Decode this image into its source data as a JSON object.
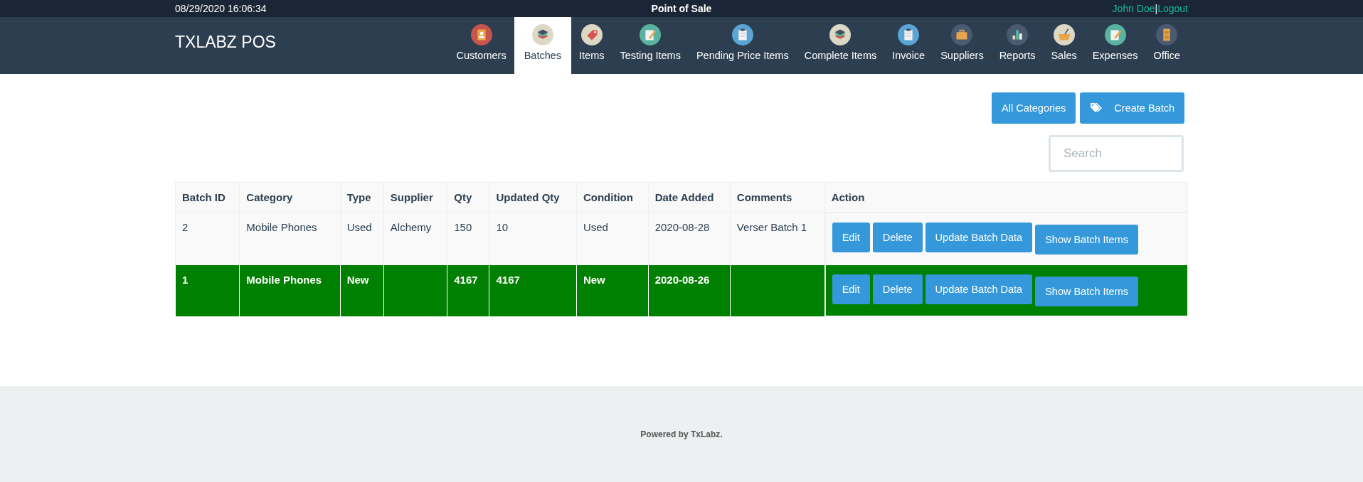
{
  "top_bar": {
    "datetime": "08/29/2020 16:06:34",
    "title": "Point of Sale",
    "user": "John Doe",
    "separator": "|",
    "logout": "Logout"
  },
  "brand": "TXLABZ POS",
  "nav": [
    {
      "label": "Customers",
      "selected": false
    },
    {
      "label": "Batches",
      "selected": true
    },
    {
      "label": "Items",
      "selected": false
    },
    {
      "label": "Testing Items",
      "selected": false
    },
    {
      "label": "Pending Price Items",
      "selected": false
    },
    {
      "label": "Complete Items",
      "selected": false
    },
    {
      "label": "Invoice",
      "selected": false
    },
    {
      "label": "Suppliers",
      "selected": false
    },
    {
      "label": "Reports",
      "selected": false
    },
    {
      "label": "Sales",
      "selected": false
    },
    {
      "label": "Expenses",
      "selected": false
    },
    {
      "label": "Office",
      "selected": false
    }
  ],
  "toolbar": {
    "buttons": [
      {
        "label": "All Categories",
        "kind": "plain"
      },
      {
        "label": "Create Batch",
        "kind": "tag"
      }
    ],
    "search": {
      "placeholder": "Search"
    }
  },
  "table": {
    "columns": [
      "Batch ID",
      "Category",
      "Type",
      "Supplier",
      "Qty",
      "Updated Qty",
      "Condition",
      "Date Added",
      "Comments",
      "Action"
    ],
    "rows": [
      {
        "highlighted": false,
        "cells": [
          "2",
          "Mobile Phones",
          "Used",
          "Alchemy",
          "150",
          "10",
          "Used",
          "2020-08-28",
          "Verser Batch 1"
        ],
        "actions": [
          "Edit",
          "Delete",
          "Update Batch Data",
          "Show Batch Items"
        ]
      },
      {
        "highlighted": true,
        "cells": [
          "1",
          "Mobile Phones",
          "New",
          "",
          "4167",
          "4167",
          "New",
          "2020-08-26",
          ""
        ],
        "actions": [
          "Edit",
          "Delete",
          "Update Batch Data",
          "Show Batch Items"
        ]
      }
    ]
  },
  "footer": "Powered by TxLabz."
}
